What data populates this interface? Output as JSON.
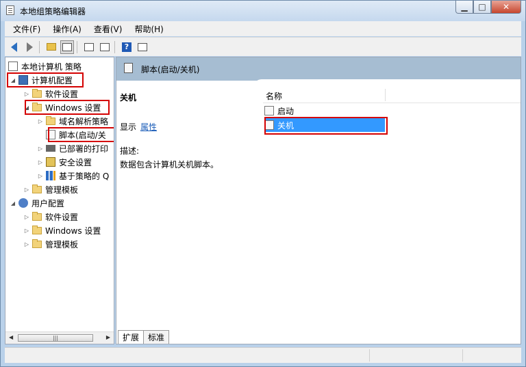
{
  "window": {
    "title": "本地组策略编辑器"
  },
  "menu": [
    {
      "label": "文件(F)"
    },
    {
      "label": "操作(A)"
    },
    {
      "label": "查看(V)"
    },
    {
      "label": "帮助(H)"
    }
  ],
  "tree": {
    "root": "本地计算机 策略",
    "items": [
      {
        "label": "计算机配置",
        "highlighted": true
      },
      {
        "label": "软件设置"
      },
      {
        "label": "Windows 设置",
        "highlighted": true
      },
      {
        "label": "域名解析策略"
      },
      {
        "label": "脚本(启动/关",
        "highlighted": true
      },
      {
        "label": "已部署的打印"
      },
      {
        "label": "安全设置"
      },
      {
        "label": "基于策略的 Q"
      },
      {
        "label": "管理模板"
      },
      {
        "label": "用户配置"
      },
      {
        "label": "软件设置"
      },
      {
        "label": "Windows 设置"
      },
      {
        "label": "管理模板"
      }
    ]
  },
  "right": {
    "header_title": "脚本(启动/关机)",
    "desc_title": "关机",
    "show_label": "显示",
    "properties_link": "属性",
    "desc_label": "描述:",
    "desc_text": "数据包含计算机关机脚本。",
    "column_name": "名称",
    "rows": [
      {
        "label": "启动",
        "selected": false
      },
      {
        "label": "关机",
        "selected": true
      }
    ],
    "tabs": [
      {
        "label": "扩展"
      },
      {
        "label": "标准"
      }
    ]
  },
  "colors": {
    "highlight_red": "#d40000",
    "selection_blue": "#3399ff",
    "header_band": "#a6bdd2"
  }
}
